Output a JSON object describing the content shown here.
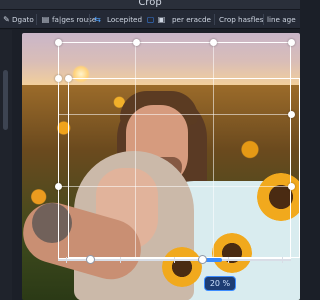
{
  "window": {
    "title": "Crop"
  },
  "toolbar": {
    "items": [
      {
        "label": "Dgato",
        "kind": "text"
      },
      {
        "label": "fa|ges rouse",
        "kind": "text"
      },
      {
        "label": "Locepited",
        "kind": "text"
      },
      {
        "label": "per eracde",
        "kind": "text"
      },
      {
        "label": "Crop hasfles",
        "kind": "text"
      },
      {
        "label": "line age",
        "kind": "text"
      }
    ],
    "icons": [
      "cursor-icon",
      "layers-icon",
      "checkmark-icon",
      "aspect-ratio-icon",
      "grid-icon"
    ]
  },
  "crop": {
    "zoom_label": "20 %",
    "slider_level": 0.62
  },
  "colors": {
    "accent": "#3b8cff",
    "background": "#1b1f28",
    "toolbar": "#242935"
  }
}
